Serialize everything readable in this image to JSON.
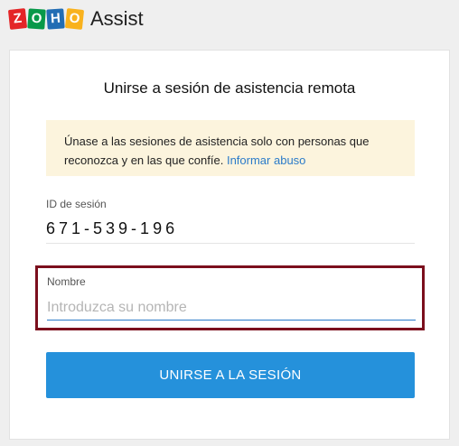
{
  "header": {
    "logo_letters": [
      "Z",
      "O",
      "H",
      "O"
    ],
    "product_name": "Assist"
  },
  "card": {
    "title": "Unirse a sesión de asistencia remota",
    "notice": {
      "text": "Únase a las sesiones de asistencia solo con personas que reconozca y en las que confíe.",
      "link": "Informar abuso"
    },
    "session": {
      "label": "ID de sesión",
      "value": "671-539-196"
    },
    "name": {
      "label": "Nombre",
      "value": "",
      "placeholder": "Introduzca su nombre"
    },
    "join_button": "UNIRSE A LA SESIÓN"
  },
  "colors": {
    "accent": "#2591db",
    "highlight_border": "#7b0f1d",
    "notice_bg": "#fcf4dd"
  }
}
